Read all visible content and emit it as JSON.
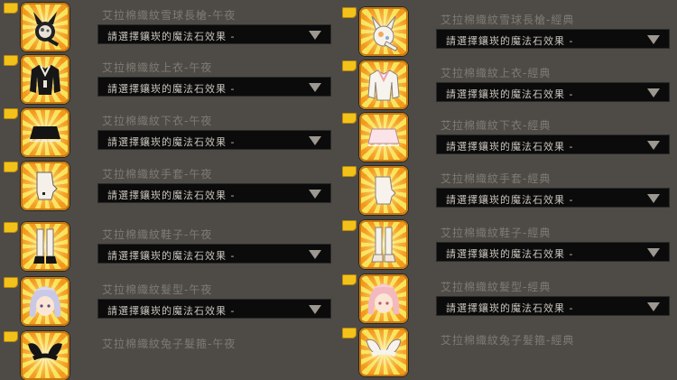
{
  "colors": {
    "background": "#4e4b47",
    "tag": "#f2c21b",
    "dropdown": "#0b0b0b",
    "name_text": "#7f7a73"
  },
  "dropdown_placeholder": "請選擇鑲崁的魔法石效果 -",
  "left_items": [
    {
      "name": "艾拉棉織紋雪球長槍-午夜",
      "icon": "midnight-snowball-spear-icon"
    },
    {
      "name": "艾拉棉織紋上衣-午夜",
      "icon": "midnight-top-icon"
    },
    {
      "name": "艾拉棉織紋下衣-午夜",
      "icon": "midnight-skirt-icon"
    },
    {
      "name": "艾拉棉織紋手套-午夜",
      "icon": "midnight-glove-icon"
    },
    {
      "name": "艾拉棉織紋鞋子-午夜",
      "icon": "midnight-shoes-icon"
    },
    {
      "name": "艾拉棉織紋髮型-午夜",
      "icon": "midnight-hairstyle-icon"
    },
    {
      "name": "艾拉棉織紋兔子髮箍-午夜",
      "icon": "midnight-bunny-headband-icon"
    }
  ],
  "right_items": [
    {
      "name": "艾拉棉織紋雪球長槍-經典",
      "icon": "classic-snowball-spear-icon"
    },
    {
      "name": "艾拉棉織紋上衣-經典",
      "icon": "classic-top-icon"
    },
    {
      "name": "艾拉棉織紋下衣-經典",
      "icon": "classic-skirt-icon"
    },
    {
      "name": "艾拉棉織紋手套-經典",
      "icon": "classic-glove-icon"
    },
    {
      "name": "艾拉棉織紋鞋子-經典",
      "icon": "classic-shoes-icon"
    },
    {
      "name": "艾拉棉織紋髮型-經典",
      "icon": "classic-hairstyle-icon"
    },
    {
      "name": "艾拉棉織紋兔子髮箍-經典",
      "icon": "classic-bunny-headband-icon"
    }
  ]
}
